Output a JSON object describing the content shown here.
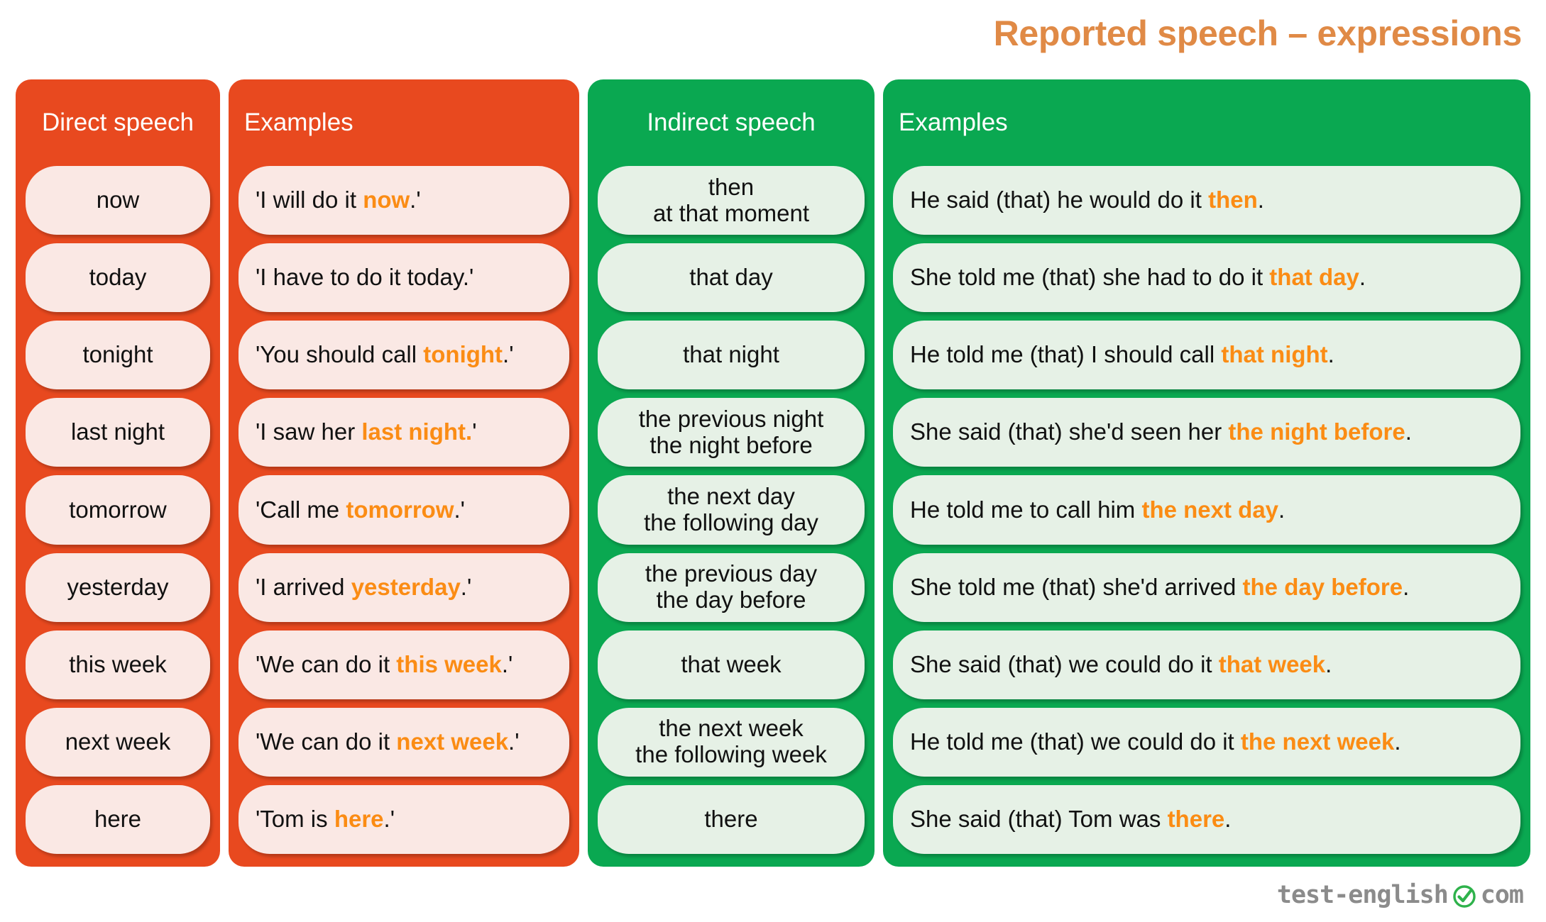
{
  "title": "Reported speech – expressions",
  "colors": {
    "orange_panel": "#e8491f",
    "green_panel": "#0aa851",
    "highlight": "#fb8c14",
    "title": "#e08a46",
    "pink_cell": "#fae8e4",
    "mint_cell": "#e6f1e6"
  },
  "headers": {
    "direct_speech": "Direct speech",
    "direct_examples": "Examples",
    "indirect_speech": "Indirect speech",
    "indirect_examples": "Examples"
  },
  "rows": [
    {
      "direct": [
        "now"
      ],
      "direct_example": [
        {
          "t": "'I will do it ",
          "hl": false
        },
        {
          "t": "now",
          "hl": true
        },
        {
          "t": ".'",
          "hl": false
        }
      ],
      "indirect": [
        "then",
        "at that moment"
      ],
      "indirect_example": [
        {
          "t": "He said (that) he would do it ",
          "hl": false
        },
        {
          "t": "then",
          "hl": true
        },
        {
          "t": ".",
          "hl": false
        }
      ]
    },
    {
      "direct": [
        "today"
      ],
      "direct_example": [
        {
          "t": "'I have to do it today.'",
          "hl": false
        }
      ],
      "indirect": [
        "that day"
      ],
      "indirect_example": [
        {
          "t": "She told me (that) she had to do it ",
          "hl": false
        },
        {
          "t": "that day",
          "hl": true
        },
        {
          "t": ".",
          "hl": false
        }
      ]
    },
    {
      "direct": [
        "tonight"
      ],
      "direct_example": [
        {
          "t": "'You should call ",
          "hl": false
        },
        {
          "t": "tonight",
          "hl": true
        },
        {
          "t": ".'",
          "hl": false
        }
      ],
      "indirect": [
        "that night"
      ],
      "indirect_example": [
        {
          "t": "He told me (that) I should call ",
          "hl": false
        },
        {
          "t": "that night",
          "hl": true
        },
        {
          "t": ".",
          "hl": false
        }
      ]
    },
    {
      "direct": [
        "last night"
      ],
      "direct_example": [
        {
          "t": "'I saw her ",
          "hl": false
        },
        {
          "t": "last night.",
          "hl": true
        },
        {
          "t": "'",
          "hl": false
        }
      ],
      "indirect": [
        "the previous night",
        "the night before"
      ],
      "indirect_example": [
        {
          "t": "She said (that) she'd seen her ",
          "hl": false
        },
        {
          "t": "the night before",
          "hl": true
        },
        {
          "t": ".",
          "hl": false
        }
      ]
    },
    {
      "direct": [
        "tomorrow"
      ],
      "direct_example": [
        {
          "t": "'Call me ",
          "hl": false
        },
        {
          "t": "tomorrow",
          "hl": true
        },
        {
          "t": ".'",
          "hl": false
        }
      ],
      "indirect": [
        "the next day",
        "the following day"
      ],
      "indirect_example": [
        {
          "t": "He told me to call him ",
          "hl": false
        },
        {
          "t": "the next day",
          "hl": true
        },
        {
          "t": ".",
          "hl": false
        }
      ]
    },
    {
      "direct": [
        "yesterday"
      ],
      "direct_example": [
        {
          "t": "'I arrived ",
          "hl": false
        },
        {
          "t": "yesterday",
          "hl": true
        },
        {
          "t": ".'",
          "hl": false
        }
      ],
      "indirect": [
        "the previous day",
        "the day before"
      ],
      "indirect_example": [
        {
          "t": "She told me (that) she'd arrived ",
          "hl": false
        },
        {
          "t": "the day before",
          "hl": true
        },
        {
          "t": ".",
          "hl": false
        }
      ]
    },
    {
      "direct": [
        "this week"
      ],
      "direct_example": [
        {
          "t": "'We can do it ",
          "hl": false
        },
        {
          "t": "this week",
          "hl": true
        },
        {
          "t": ".'",
          "hl": false
        }
      ],
      "indirect": [
        "that week"
      ],
      "indirect_example": [
        {
          "t": "She said (that) we could do it ",
          "hl": false
        },
        {
          "t": "that week",
          "hl": true
        },
        {
          "t": ".",
          "hl": false
        }
      ]
    },
    {
      "direct": [
        "next week"
      ],
      "direct_example": [
        {
          "t": "'We can do it ",
          "hl": false
        },
        {
          "t": "next week",
          "hl": true
        },
        {
          "t": ".'",
          "hl": false
        }
      ],
      "indirect": [
        "the next week",
        "the following week"
      ],
      "indirect_example": [
        {
          "t": "He told me (that) we could do it ",
          "hl": false
        },
        {
          "t": "the next week",
          "hl": true
        },
        {
          "t": ".",
          "hl": false
        }
      ]
    },
    {
      "direct": [
        "here"
      ],
      "direct_example": [
        {
          "t": "'Tom is ",
          "hl": false
        },
        {
          "t": "here",
          "hl": true
        },
        {
          "t": ".'",
          "hl": false
        }
      ],
      "indirect": [
        "there"
      ],
      "indirect_example": [
        {
          "t": "She said (that) Tom was ",
          "hl": false
        },
        {
          "t": "there",
          "hl": true
        },
        {
          "t": ".",
          "hl": false
        }
      ]
    }
  ],
  "footer": {
    "logo_left": "test-english",
    "logo_icon": "green-check-circle-icon",
    "logo_right": "com"
  }
}
